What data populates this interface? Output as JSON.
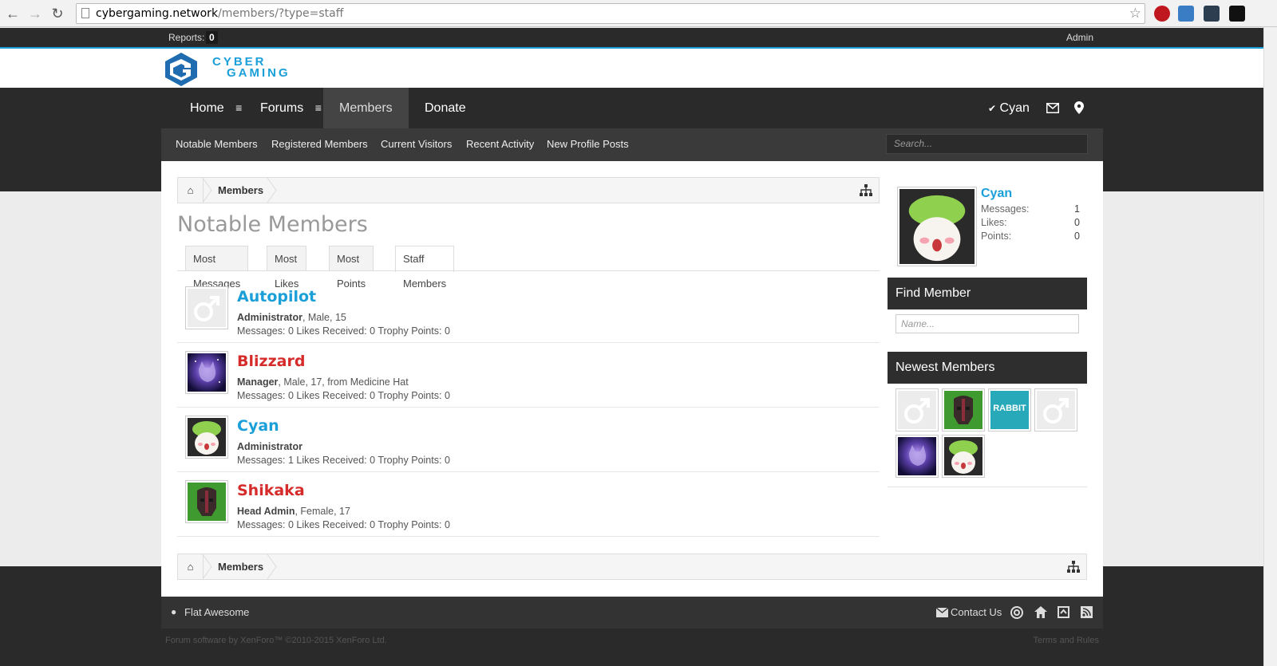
{
  "browser": {
    "url_host": "cybergaming.network",
    "url_path": "/members/?type=staff"
  },
  "topbar": {
    "reports_label": "Reports:",
    "reports_count": "0",
    "admin_label": "Admin"
  },
  "logo": {
    "line1": "CYBER",
    "line2": "GAMING"
  },
  "nav": {
    "tabs": [
      {
        "label": "Home"
      },
      {
        "label": "Forums"
      },
      {
        "label": "Members"
      },
      {
        "label": "Donate"
      }
    ],
    "user_label": "Cyan"
  },
  "subnav": {
    "links": [
      "Notable Members",
      "Registered Members",
      "Current Visitors",
      "Recent Activity",
      "New Profile Posts"
    ],
    "search_placeholder": "Search..."
  },
  "breadcrumb": {
    "label": "Members"
  },
  "page_title": "Notable Members",
  "tabs": [
    "Most Messages",
    "Most Likes",
    "Most Points",
    "Staff Members"
  ],
  "members": [
    {
      "name": "Autopilot",
      "color": "#1a9fd9",
      "role": "Administrator",
      "details": ", Male, 15",
      "messages": "0",
      "likes": "0",
      "points": "0"
    },
    {
      "name": "Blizzard",
      "color": "#d62b2b",
      "role": "Manager",
      "details": ", Male, 17, from Medicine Hat",
      "messages": "0",
      "likes": "0",
      "points": "0"
    },
    {
      "name": "Cyan",
      "color": "#1a9fd9",
      "role": "Administrator",
      "details": "",
      "messages": "1",
      "likes": "0",
      "points": "0"
    },
    {
      "name": "Shikaka",
      "color": "#d62b2b",
      "role": "Head Admin",
      "details": ", Female, 17",
      "messages": "0",
      "likes": "0",
      "points": "0"
    }
  ],
  "stat_labels": {
    "messages": "Messages:",
    "likes": "Likes Received:",
    "points": "Trophy Points:"
  },
  "sidebar": {
    "user": {
      "name": "Cyan",
      "messages_label": "Messages:",
      "messages": "1",
      "likes_label": "Likes:",
      "likes": "0",
      "points_label": "Points:",
      "points": "0"
    },
    "find_member_title": "Find Member",
    "find_member_placeholder": "Name...",
    "newest_members_title": "Newest Members",
    "rabbit_text": "RABBIT"
  },
  "footer": {
    "style_label": "Flat Awesome",
    "contact_label": "Contact Us",
    "copyright": "Forum software by XenForo™ ©2010-2015 XenForo Ltd.",
    "terms": "Terms and Rules"
  },
  "colors": {
    "accent": "#1a9fd9",
    "staff_red": "#d62b2b",
    "dark": "#2a2a2a"
  }
}
